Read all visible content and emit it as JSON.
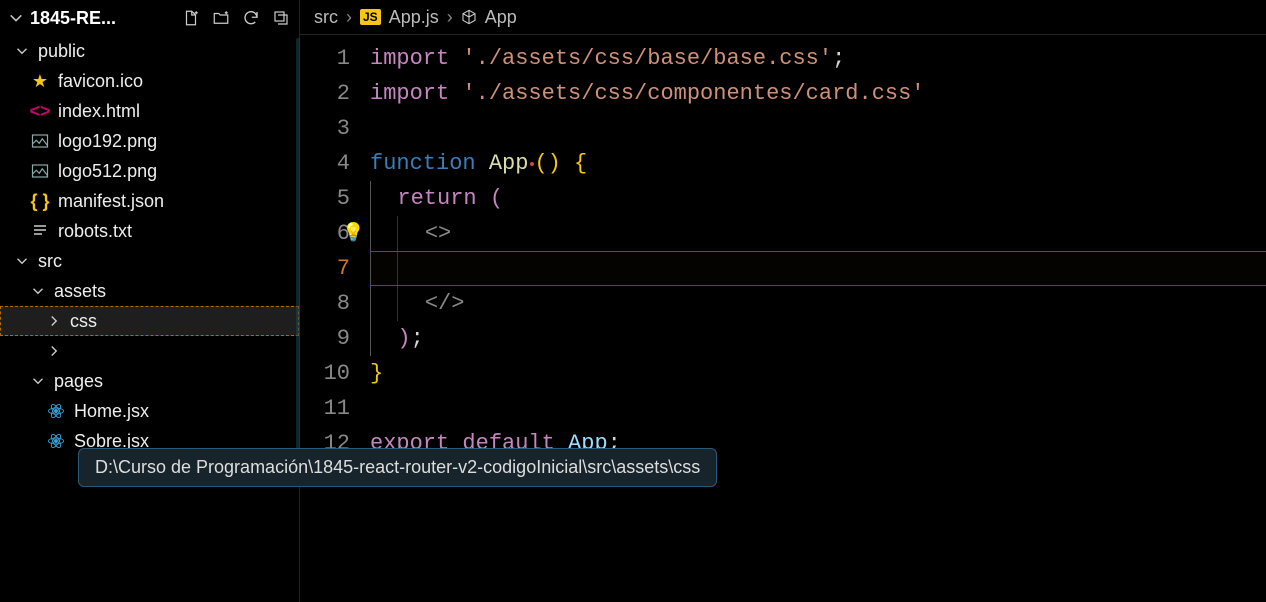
{
  "sidebar": {
    "project_name": "1845-RE...",
    "items": [
      {
        "label": "public",
        "type": "folder-open",
        "indent": 0
      },
      {
        "label": "favicon.ico",
        "type": "star",
        "indent": 1
      },
      {
        "label": "index.html",
        "type": "code",
        "indent": 1
      },
      {
        "label": "logo192.png",
        "type": "img",
        "indent": 1
      },
      {
        "label": "logo512.png",
        "type": "img",
        "indent": 1
      },
      {
        "label": "manifest.json",
        "type": "brace",
        "indent": 1
      },
      {
        "label": "robots.txt",
        "type": "lines",
        "indent": 1
      },
      {
        "label": "src",
        "type": "folder-open",
        "indent": 0
      },
      {
        "label": "assets",
        "type": "folder-open",
        "indent": 1
      },
      {
        "label": "css",
        "type": "folder-closed",
        "indent": 2,
        "active": true
      },
      {
        "label": "",
        "type": "folder-closed",
        "indent": 2
      },
      {
        "label": "pages",
        "type": "folder-open",
        "indent": 1
      },
      {
        "label": "Home.jsx",
        "type": "react",
        "indent": 2
      },
      {
        "label": "Sobre.jsx",
        "type": "react",
        "indent": 2
      }
    ]
  },
  "breadcrumb": {
    "seg1": "src",
    "seg2": "App.js",
    "seg3": "App",
    "js_badge": "JS"
  },
  "tooltip": "D:\\Curso de Programación\\1845-react-router-v2-codigoInicial\\src\\assets\\css",
  "code": {
    "line1_kw": "import",
    "line1_str": "'./assets/css/base/base.css'",
    "line1_end": ";",
    "line2_kw": "import",
    "line2_str": "'./assets/css/componentes/card.css'",
    "line4_a": "function",
    "line4_b": "App",
    "line4_c": "()",
    "line4_d": " {",
    "line5_a": "return",
    "line5_b": " (",
    "line6_a": "<>",
    "line8_a": "</>",
    "line9_a": ")",
    "line9_b": ";",
    "line10_a": "}",
    "line12_a": "export",
    "line12_b": "default",
    "line12_c": "App",
    "line12_d": ";"
  },
  "line_numbers": [
    "1",
    "2",
    "3",
    "4",
    "5",
    "6",
    "7",
    "8",
    "9",
    "10",
    "11",
    "12"
  ]
}
